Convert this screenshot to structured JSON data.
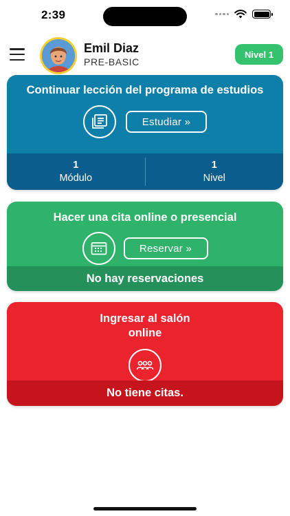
{
  "status_bar": {
    "time": "2:39"
  },
  "header": {
    "user_name": "Emil Diaz",
    "user_level": "PRE-BASIC",
    "level_badge": "Nivel 1"
  },
  "cards": {
    "study": {
      "title": "Continuar lección del programa de estudios",
      "button_label": "Estudiar »",
      "icon": "course-book-icon",
      "color": "#0d7fa8",
      "footer_color": "#0a5d8c",
      "stats": [
        {
          "value": "1",
          "label": "Módulo"
        },
        {
          "value": "1",
          "label": "Nivel"
        }
      ]
    },
    "booking": {
      "title": "Hacer una cita online o presencial",
      "button_label": "Reservar »",
      "icon": "calendar-icon",
      "color": "#2fb36a",
      "footer_color": "#24905a",
      "footer": "No hay reservaciones"
    },
    "classroom": {
      "title_line1": "Ingresar al salón",
      "title_line2": "online",
      "icon": "group-icon",
      "color": "#ea232d",
      "footer_color": "#c5141c",
      "footer": "No tiene citas."
    }
  }
}
